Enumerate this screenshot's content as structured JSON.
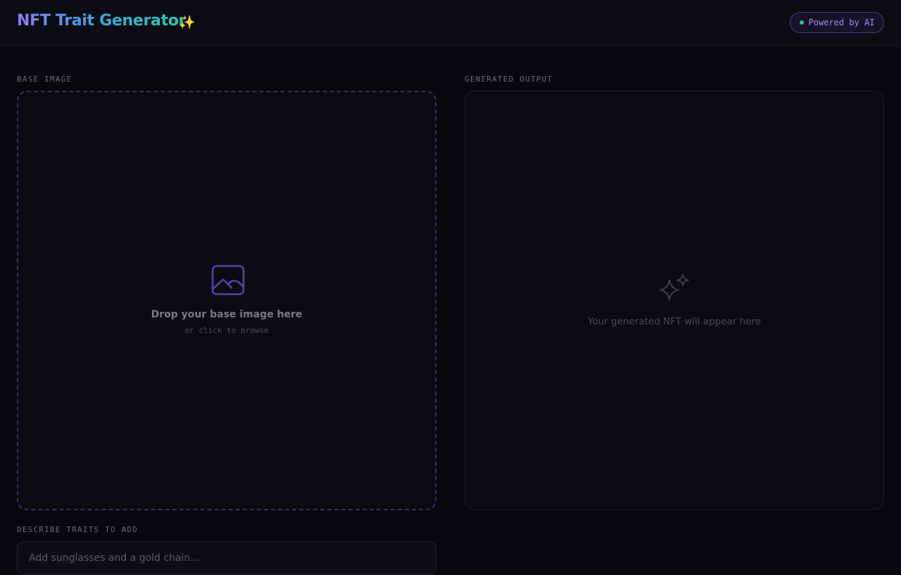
{
  "header": {
    "title": "NFT Trait Generator",
    "title_emoji": "✨",
    "badge_label": "Powered by AI"
  },
  "base_image": {
    "section_label": "BASE IMAGE",
    "icon": "image-icon",
    "drop_text": "Drop your base image here",
    "browse_text": "or click to browse"
  },
  "output": {
    "section_label": "GENERATED OUTPUT",
    "icon": "sparkles-icon",
    "placeholder_text": "Your generated NFT will appear here"
  },
  "traits": {
    "section_label": "DESCRIBE TRAITS TO ADD",
    "input_value": "",
    "input_placeholder": "Add sunglasses and a gold chain..."
  },
  "colors": {
    "background": "#08080d",
    "accent_purple": "#8b7cf6",
    "accent_teal": "#2cc8a8",
    "badge_text": "#a58cf5"
  }
}
